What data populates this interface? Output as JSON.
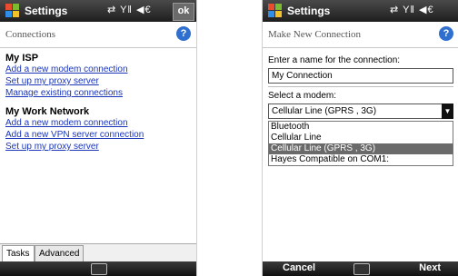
{
  "screen1": {
    "title": "Settings",
    "status_icons": "⇄ Y‖ ◀€",
    "ok_label": "ok",
    "subheader": "Connections",
    "help_icon": "?",
    "sections": [
      {
        "title": "My ISP",
        "links": [
          "Add a new modem connection",
          "Set up my proxy server",
          "Manage existing connections"
        ]
      },
      {
        "title": "My Work Network",
        "links": [
          "Add a new modem connection",
          "Add a new VPN server connection",
          "Set up my proxy server"
        ]
      }
    ],
    "tabs": [
      "Tasks",
      "Advanced"
    ]
  },
  "screen2": {
    "title": "Settings",
    "status_icons": "⇄ Y‖ ◀€",
    "subheader": "Make New Connection",
    "help_icon": "?",
    "name_label": "Enter a name for the connection:",
    "name_value": "My Connection",
    "modem_label": "Select a modem:",
    "modem_selected": "Cellular Line (GPRS , 3G)",
    "modem_options": [
      "Bluetooth",
      "Cellular Line",
      "Cellular Line (GPRS , 3G)",
      "Hayes Compatible on COM1:"
    ],
    "softkey_left": "Cancel",
    "softkey_right": "Next"
  }
}
